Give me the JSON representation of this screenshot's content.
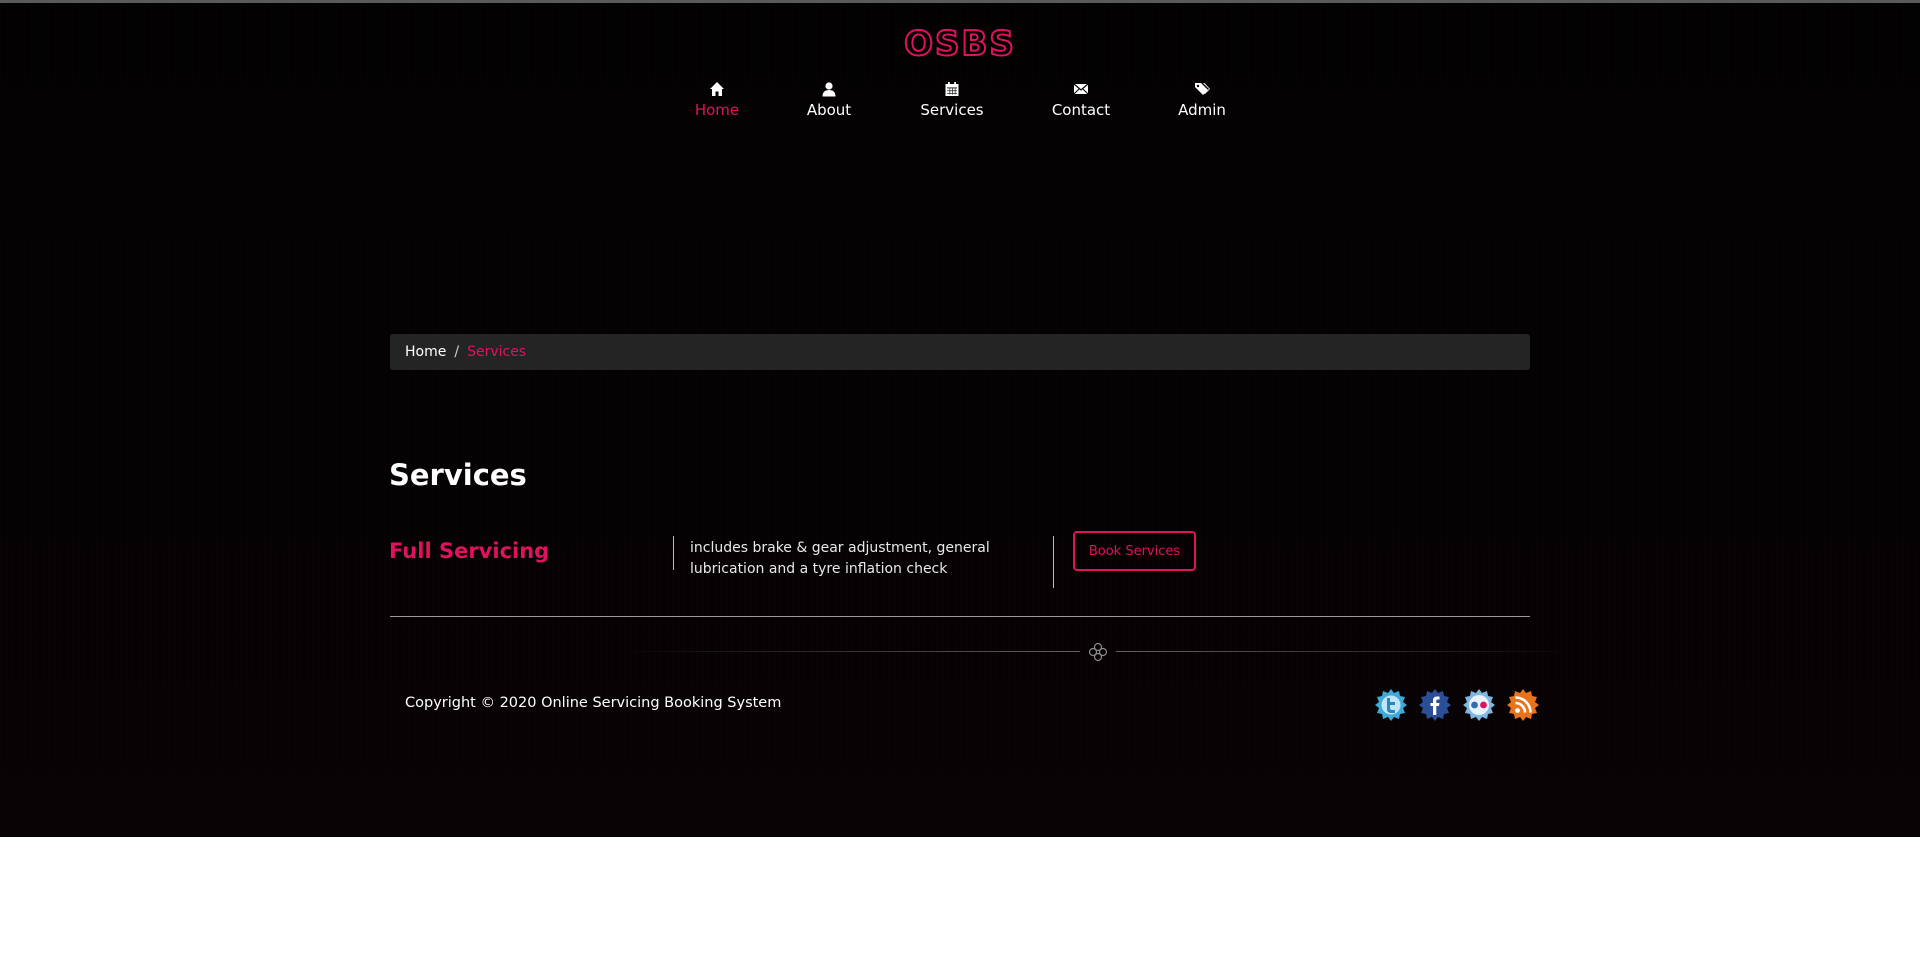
{
  "brand": {
    "logo_text": "OSBS",
    "accent_color": "#e0115f"
  },
  "nav": {
    "items": [
      {
        "label": "Home",
        "icon": "home-icon",
        "active": true
      },
      {
        "label": "About",
        "icon": "user-icon",
        "active": false
      },
      {
        "label": "Services",
        "icon": "calendar-icon",
        "active": false
      },
      {
        "label": "Contact",
        "icon": "envelope-icon",
        "active": false
      },
      {
        "label": "Admin",
        "icon": "tags-icon",
        "active": false
      }
    ]
  },
  "breadcrumb": {
    "home": "Home",
    "separator": "/",
    "current": "Services"
  },
  "main": {
    "title": "Services",
    "service": {
      "name": "Full Servicing",
      "description": "includes brake & gear adjustment, general lubrication and a tyre inflation check",
      "button_label": "Book Services"
    }
  },
  "footer": {
    "copyright": "Copyright © 2020 Online Servicing Booking System",
    "social": [
      {
        "name": "twitter-icon",
        "color": "#3fa9d8"
      },
      {
        "name": "facebook-icon",
        "color": "#2b4f96"
      },
      {
        "name": "flickr-icon",
        "color": "#7fb7e0"
      },
      {
        "name": "rss-icon",
        "color": "#e8731c"
      }
    ]
  }
}
